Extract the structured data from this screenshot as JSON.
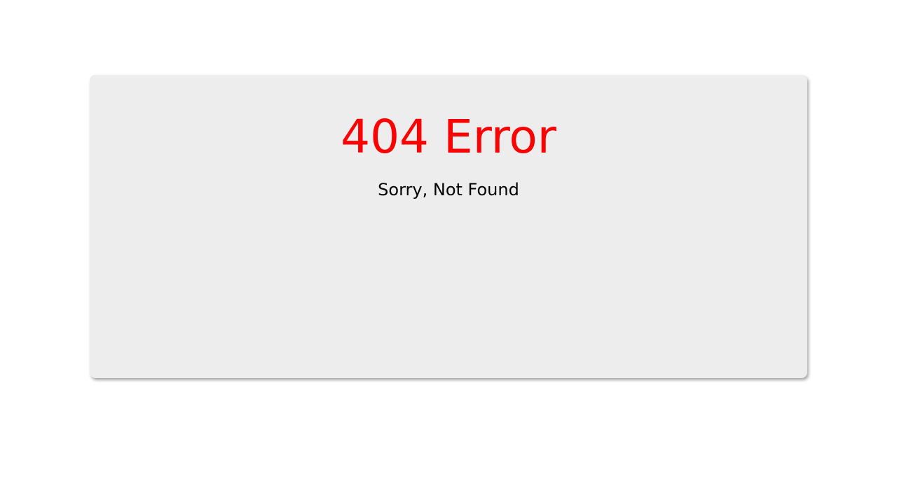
{
  "error": {
    "title": "404 Error",
    "message": "Sorry, Not Found",
    "title_color": "#ff0000"
  }
}
